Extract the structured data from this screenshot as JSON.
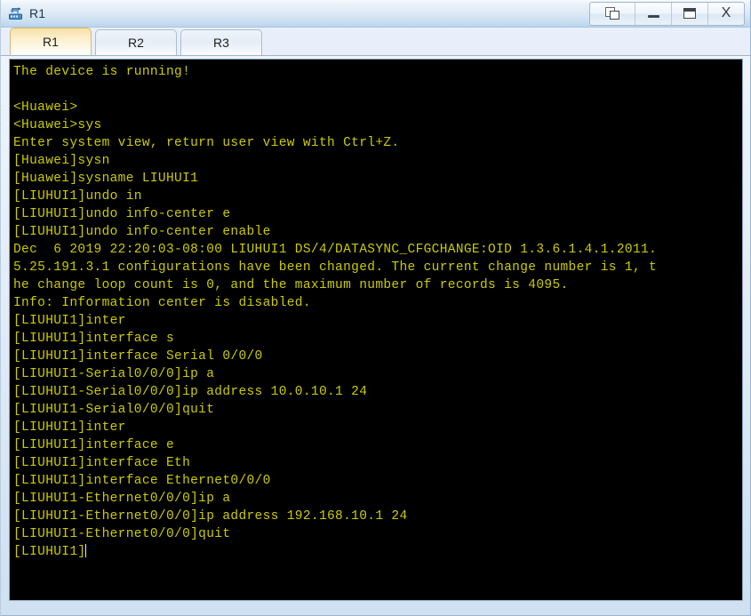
{
  "window": {
    "title": "R1",
    "icon": "router-icon",
    "buttons": [
      {
        "name": "cascade-windows-button",
        "glyph": "cascade-icon",
        "label": ""
      },
      {
        "name": "minimize-button",
        "glyph": "minimize-icon",
        "label": ""
      },
      {
        "name": "maximize-button",
        "glyph": "maximize-icon",
        "label": ""
      },
      {
        "name": "close-button",
        "glyph": "close-icon",
        "label": "X"
      }
    ]
  },
  "tabs": [
    {
      "label": "R1",
      "active": true
    },
    {
      "label": "R2",
      "active": false
    },
    {
      "label": "R3",
      "active": false
    }
  ],
  "terminal": {
    "foreground": "#cccb00",
    "background": "#000000",
    "cursor_color": "#e8e8e8",
    "lines": [
      "The device is running!",
      "",
      "<Huawei>",
      "<Huawei>sys",
      "Enter system view, return user view with Ctrl+Z.",
      "[Huawei]sysn",
      "[Huawei]sysname LIUHUI1",
      "[LIUHUI1]undo in",
      "[LIUHUI1]undo info-center e",
      "[LIUHUI1]undo info-center enable",
      "Dec  6 2019 22:20:03-08:00 LIUHUI1 DS/4/DATASYNC_CFGCHANGE:OID 1.3.6.1.4.1.2011.",
      "5.25.191.3.1 configurations have been changed. The current change number is 1, t",
      "he change loop count is 0, and the maximum number of records is 4095.",
      "Info: Information center is disabled.",
      "[LIUHUI1]inter",
      "[LIUHUI1]interface s",
      "[LIUHUI1]interface Serial 0/0/0",
      "[LIUHUI1-Serial0/0/0]ip a",
      "[LIUHUI1-Serial0/0/0]ip address 10.0.10.1 24",
      "[LIUHUI1-Serial0/0/0]quit",
      "[LIUHUI1]inter",
      "[LIUHUI1]interface e",
      "[LIUHUI1]interface Eth",
      "[LIUHUI1]interface Ethernet0/0/0",
      "[LIUHUI1-Ethernet0/0/0]ip a",
      "[LIUHUI1-Ethernet0/0/0]ip address 192.168.10.1 24",
      "[LIUHUI1-Ethernet0/0/0]quit"
    ],
    "prompt": "[LIUHUI1]"
  }
}
